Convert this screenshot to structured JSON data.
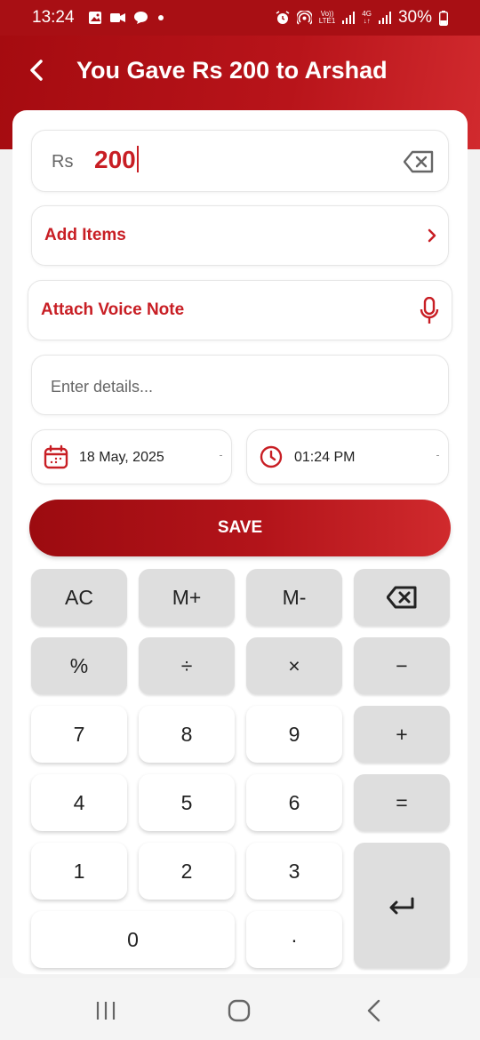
{
  "status_bar": {
    "time": "13:24",
    "network_top": "Vo))",
    "network_bottom": "LTE1",
    "net4g_top": "4G",
    "net4g_bottom": "↓↑",
    "battery": "30%"
  },
  "header": {
    "title": "You Gave Rs 200 to Arshad"
  },
  "amount": {
    "currency": "Rs",
    "value": "200"
  },
  "add_items": {
    "label": "Add Items"
  },
  "voice_note": {
    "label": "Attach Voice Note"
  },
  "details": {
    "placeholder": "Enter details..."
  },
  "date": {
    "value": "18 May, 2025"
  },
  "time": {
    "value": "01:24 PM"
  },
  "save": {
    "label": "SAVE"
  },
  "keypad": {
    "ac": "AC",
    "m_plus": "M+",
    "m_minus": "M-",
    "percent": "%",
    "divide": "÷",
    "multiply": "×",
    "minus": "−",
    "k7": "7",
    "k8": "8",
    "k9": "9",
    "plus": "+",
    "k4": "4",
    "k5": "5",
    "k6": "6",
    "equals": "=",
    "k1": "1",
    "k2": "2",
    "k3": "3",
    "k0": "0",
    "dot": "·"
  },
  "colors": {
    "brand_red": "#b3141a",
    "accent_red": "#c81e24",
    "key_gray": "#dedede"
  }
}
